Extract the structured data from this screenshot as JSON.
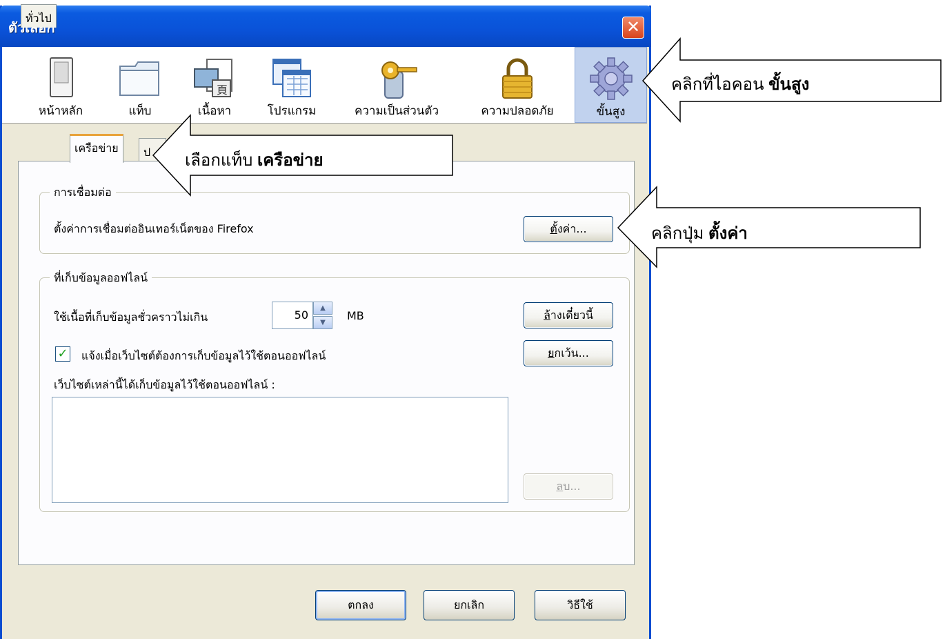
{
  "window": {
    "title": "ตัวเลือก",
    "close_glyph": "✕"
  },
  "toolbar": {
    "categories": [
      {
        "label": "หน้าหลัก",
        "icon": "main-switch-icon"
      },
      {
        "label": "แท็บ",
        "icon": "tabs-folder-icon"
      },
      {
        "label": "เนื้อหา",
        "icon": "content-icon"
      },
      {
        "label": "โปรแกรม",
        "icon": "applications-icon"
      },
      {
        "label": "ความเป็นส่วนตัว",
        "icon": "privacy-key-icon"
      },
      {
        "label": "ความปลอดภัย",
        "icon": "security-lock-icon"
      },
      {
        "label": "ขั้นสูง",
        "icon": "advanced-gear-icon",
        "selected": true
      }
    ]
  },
  "tabs": {
    "general": "ทั่วไป",
    "network": "เครือข่าย",
    "update": "ป"
  },
  "connection": {
    "legend": "การเชื่อมต่อ",
    "description": "ตั้งค่าการเชื่อมต่ออินเทอร์เน็ตของ Firefox",
    "settings_button_u": "ตั้",
    "settings_button_rest": "งค่า..."
  },
  "offline": {
    "legend": "ที่เก็บข้อมูลออฟไลน์",
    "cache_label": "ใช้เนื้อที่เก็บข้อมูลชั่วคราวไม่เกิน",
    "cache_value": "50",
    "cache_unit": "MB",
    "clear_button_u": "ล้",
    "clear_button_rest": "างเดี๋ยวนี้",
    "notify_label": "แจ้งเมื่อเว็บไซต์ต้องการเก็บข้อมูลไว้ใช้ตอนออฟไลน์",
    "notify_checked": true,
    "exceptions_button_u": "ย",
    "exceptions_button_rest": "กเว้น...",
    "sites_label": "เว็บไซต์เหล่านี้ได้เก็บข้อมูลไว้ใช้ตอนออฟไลน์ :",
    "remove_button_u": "ล",
    "remove_button_rest": "บ..."
  },
  "footer": {
    "ok": "ตกลง",
    "cancel": "ยกเลิก",
    "help": "วิธีใช้"
  },
  "callouts": {
    "advanced_prefix": "คลิกที่ไอคอน ",
    "advanced_bold": "ขั้นสูง",
    "network_prefix": "เลือกแท็บ ",
    "network_bold": "เครือข่าย",
    "settings_prefix": "คลิกปุ่ม ",
    "settings_bold": "ตั้งค่า"
  },
  "colors": {
    "titlebar": "#0a52d8",
    "selected_category": "#c1d2ee",
    "active_tab_accent": "#e8a33b",
    "checkmark": "#21a121"
  }
}
